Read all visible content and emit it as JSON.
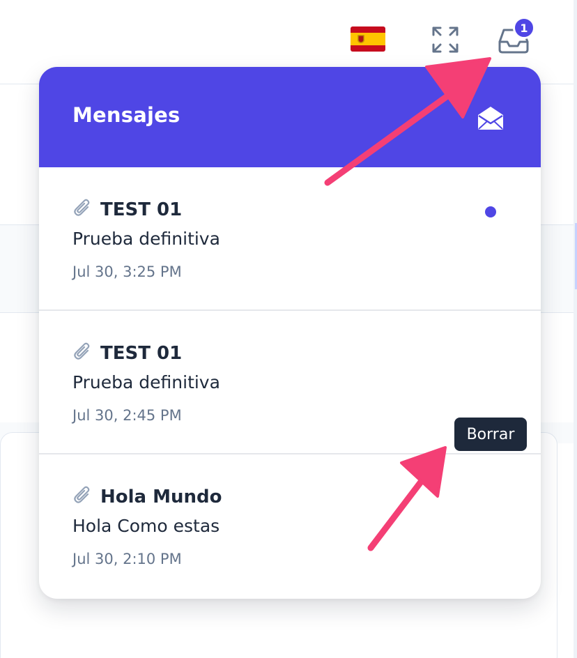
{
  "toolbar": {
    "language_flag": "spain-flag",
    "fullscreen_icon": "expand-icon",
    "inbox_icon": "inbox-icon",
    "inbox_badge": "1"
  },
  "panel": {
    "title": "Mensajes",
    "header_icon": "mail-open-icon",
    "accent_color": "#4f46e5",
    "messages": [
      {
        "subject": "TEST 01",
        "preview": "Prueba definitiva",
        "time": "Jul 30, 3:25 PM",
        "unread": true
      },
      {
        "subject": "TEST 01",
        "preview": "Prueba definitiva",
        "time": "Jul 30, 2:45 PM",
        "unread": false
      },
      {
        "subject": "Hola Mundo",
        "preview": "Hola Como estas",
        "time": "Jul 30, 2:10 PM",
        "unread": false
      }
    ]
  },
  "tooltip": {
    "text": "Borrar"
  },
  "annotation": {
    "arrow_color": "#f43f75"
  }
}
